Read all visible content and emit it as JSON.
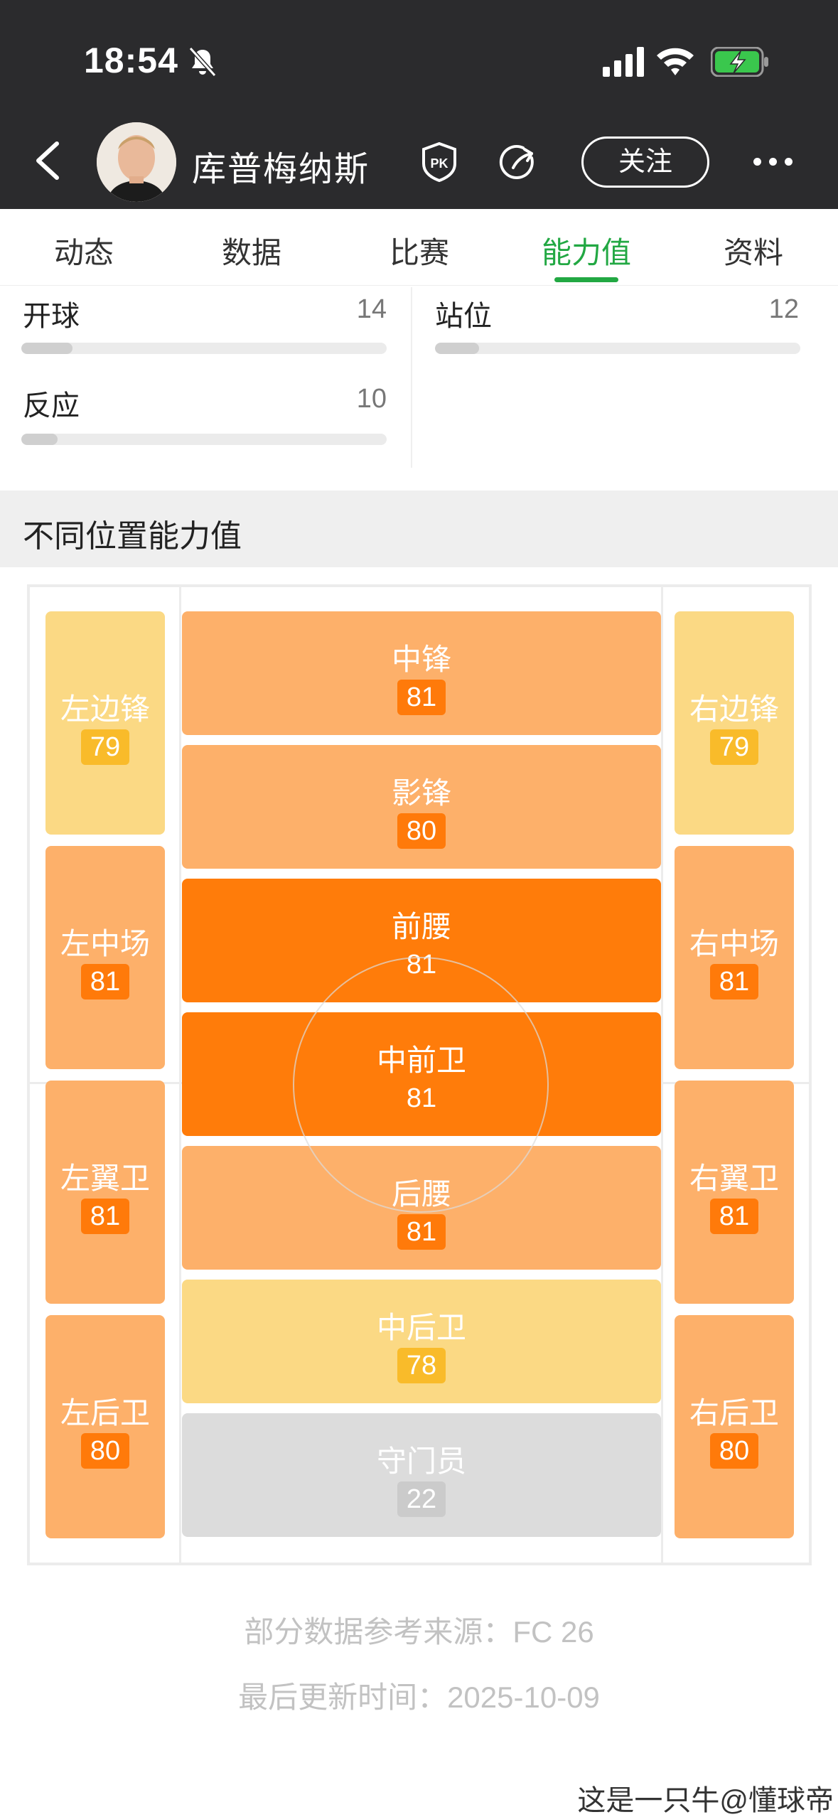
{
  "status_bar": {
    "time": "18:54"
  },
  "header": {
    "player_name": "库普梅纳斯",
    "follow_label": "关注",
    "pk_label": "PK"
  },
  "tabs": [
    {
      "label": "动态"
    },
    {
      "label": "数据"
    },
    {
      "label": "比赛"
    },
    {
      "label": "能力值",
      "active": true
    },
    {
      "label": "资料"
    }
  ],
  "stats": [
    {
      "label": "开球",
      "value": "14",
      "fraction": 0.14
    },
    {
      "label": "站位",
      "value": "12",
      "fraction": 0.12
    },
    {
      "label": "反应",
      "value": "10",
      "fraction": 0.1
    }
  ],
  "section": {
    "title": "不同位置能力值"
  },
  "positions": {
    "lw": {
      "name": "左边锋",
      "score": "79"
    },
    "rw": {
      "name": "右边锋",
      "score": "79"
    },
    "st": {
      "name": "中锋",
      "score": "81"
    },
    "cf": {
      "name": "影锋",
      "score": "80"
    },
    "lm": {
      "name": "左中场",
      "score": "81"
    },
    "rm": {
      "name": "右中场",
      "score": "81"
    },
    "cam": {
      "name": "前腰",
      "score": "81"
    },
    "cm": {
      "name": "中前卫",
      "score": "81"
    },
    "lwb": {
      "name": "左翼卫",
      "score": "81"
    },
    "rwb": {
      "name": "右翼卫",
      "score": "81"
    },
    "cdm": {
      "name": "后腰",
      "score": "81"
    },
    "lb": {
      "name": "左后卫",
      "score": "80"
    },
    "rb": {
      "name": "右后卫",
      "score": "80"
    },
    "cb": {
      "name": "中后卫",
      "score": "78"
    },
    "gk": {
      "name": "守门员",
      "score": "22"
    }
  },
  "footer": {
    "source": "部分数据参考来源：FC 26",
    "updated": "最后更新时间：2025-10-09"
  },
  "watermark": "这是一只牛@懂球帝",
  "colors": {
    "accent_green": "#22a843",
    "rating_strong": "#ff7c0a",
    "rating_mid": "#fdb06a",
    "rating_light": "#fbd984",
    "rating_gk": "#dcdcdc",
    "header_bg": "#2b2b2d"
  }
}
